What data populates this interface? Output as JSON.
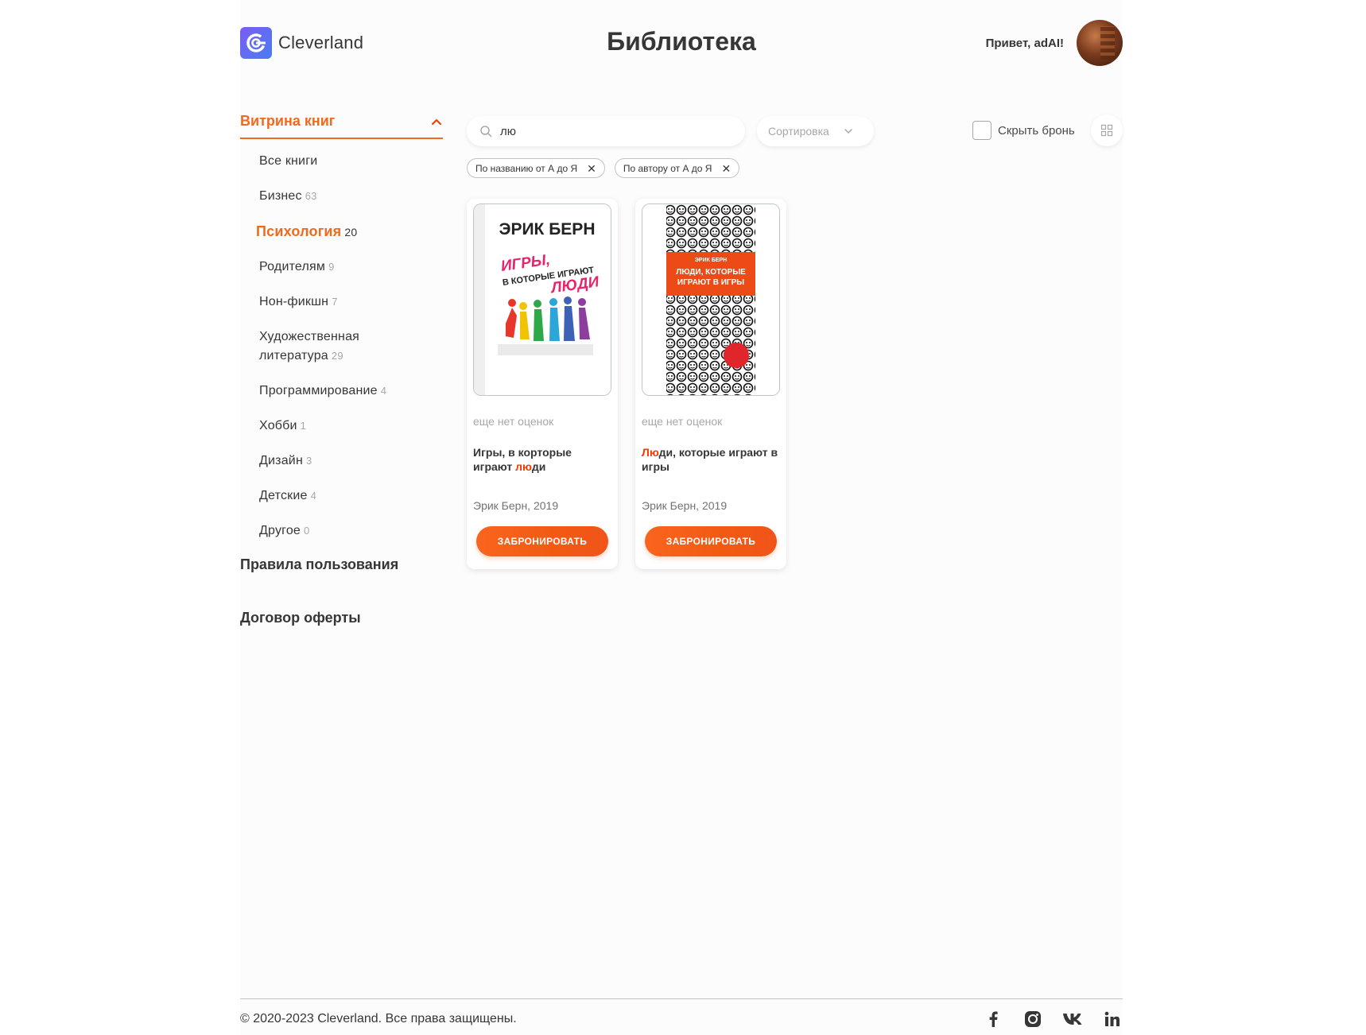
{
  "header": {
    "logo_text": "Cleverland",
    "page_title": "Библиотека",
    "greeting": "Привет, adAI!"
  },
  "sidebar": {
    "showcase_label": "Витрина книг",
    "categories": [
      {
        "label": "Все книги",
        "count": ""
      },
      {
        "label": "Бизнес",
        "count": "63"
      },
      {
        "label": "Психология",
        "count": "20",
        "active": true
      },
      {
        "label": "Родителям",
        "count": "9"
      },
      {
        "label": "Нон-фикшн",
        "count": "7"
      },
      {
        "label": "Художественная литература",
        "count": "29"
      },
      {
        "label": "Программирование",
        "count": "4"
      },
      {
        "label": "Хобби",
        "count": "1"
      },
      {
        "label": "Дизайн",
        "count": "3"
      },
      {
        "label": "Детские",
        "count": "4"
      },
      {
        "label": "Другое",
        "count": "0"
      }
    ],
    "rules_link": "Правила пользования",
    "offer_link": "Договор оферты"
  },
  "toolbar": {
    "search_value": "лю",
    "sort_label": "Сортировка",
    "hide_booked_label": "Скрыть бронь"
  },
  "filters": [
    {
      "label": "По названию от А до Я"
    },
    {
      "label": "По автору от А до Я"
    }
  ],
  "books": [
    {
      "rating": "еще нет оценок",
      "title_parts": [
        "Игры, в корторые играют ",
        "лю",
        "ди"
      ],
      "author": "Эрик Берн, 2019",
      "button": "ЗАБРОНИРОВАТЬ",
      "cover_author": "ЭРИК БЕРН",
      "cover_title": [
        "ИГРЫ,",
        "В КОТОРЫЕ ИГРАЮТ",
        "ЛЮДИ"
      ]
    },
    {
      "rating": "еще нет оценок",
      "title_parts": [
        "",
        "Лю",
        "ди, которые играют в игры"
      ],
      "author": "Эрик Берн, 2019",
      "button": "ЗАБРОНИРОВАТЬ",
      "cover_author": "ЭРИК БЕРН",
      "cover_title": [
        "ЛЮДИ, КОТОРЫЕ",
        "ИГРАЮТ В ИГРЫ"
      ]
    }
  ],
  "footer": {
    "copyright": "© 2020-2023 Cleverland. Все права защищены.",
    "socials": [
      "facebook-icon",
      "instagram-icon",
      "vk-icon",
      "linkedin-icon"
    ]
  },
  "colors": {
    "accent": "#f06a1e",
    "highlight": "#f83600",
    "text": "#363636",
    "muted": "#a7a7a7"
  }
}
